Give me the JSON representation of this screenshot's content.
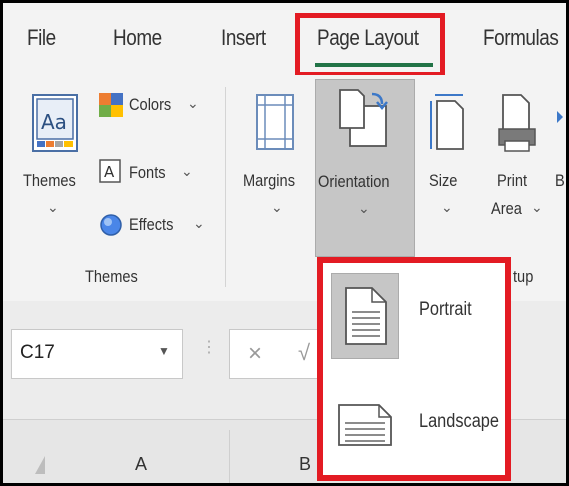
{
  "tabs": [
    {
      "label": "File"
    },
    {
      "label": "Home"
    },
    {
      "label": "Insert"
    },
    {
      "label": "Page Layout"
    },
    {
      "label": "Formulas"
    }
  ],
  "ribbon": {
    "themes": {
      "label": "Themes",
      "chevron": "⌄"
    },
    "colors": {
      "label": "Colors",
      "chevron": "⌄"
    },
    "fonts": {
      "label": "Fonts",
      "chevron": "⌄"
    },
    "effects": {
      "label": "Effects",
      "chevron": "⌄"
    },
    "themes_group": "Themes",
    "margins": {
      "label": "Margins",
      "chevron": "⌄"
    },
    "orientation": {
      "label": "Orientation",
      "chevron": "⌄"
    },
    "size": {
      "label": "Size",
      "chevron": "⌄"
    },
    "print_area": {
      "label_line1": "Print",
      "label_line2": "Area",
      "chevron": "⌄"
    },
    "cut_letter": "B",
    "page_setup_group_partial": "tup"
  },
  "formula_bar": {
    "name_box": "C17",
    "cancel_symbol": "×",
    "checkmark_partial": "√"
  },
  "sheet": {
    "col_a": "A",
    "col_b": "B"
  },
  "orientation_menu": {
    "items": [
      {
        "label": "Portrait"
      },
      {
        "label": "Landscape"
      }
    ]
  },
  "colors": {
    "highlight": "#e31b23",
    "excel_green": "#217346"
  }
}
